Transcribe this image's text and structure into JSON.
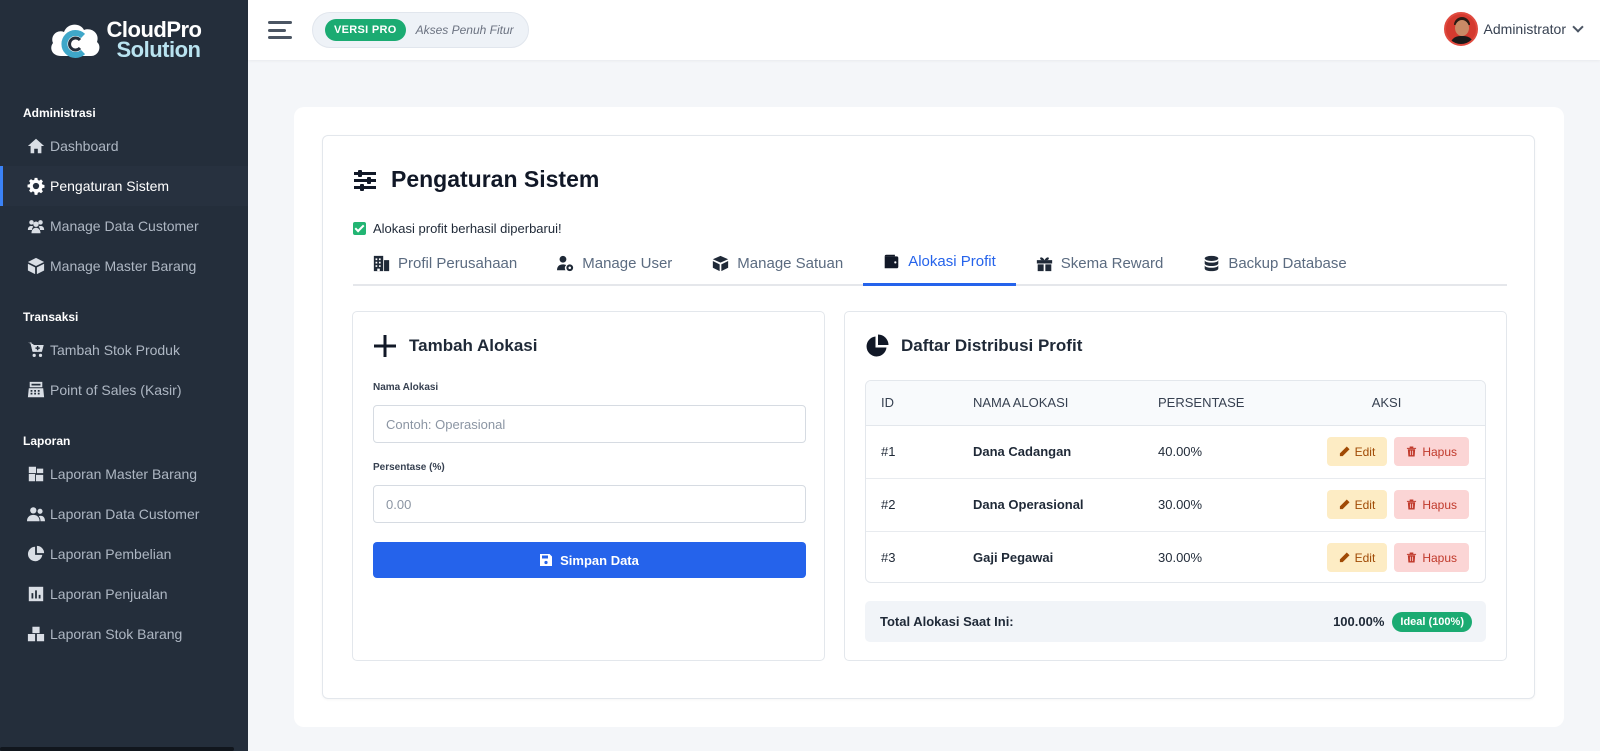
{
  "brand": {
    "line1": "CloudPro",
    "line2": "Solution"
  },
  "sidebar": {
    "sections": [
      {
        "title": "Administrasi",
        "items": [
          {
            "label": "Dashboard",
            "icon": "home-icon"
          },
          {
            "label": "Pengaturan Sistem",
            "icon": "gear-icon",
            "active": true
          },
          {
            "label": "Manage Data Customer",
            "icon": "users-icon"
          },
          {
            "label": "Manage Master Barang",
            "icon": "box-icon"
          }
        ]
      },
      {
        "title": "Transaksi",
        "items": [
          {
            "label": "Tambah Stok Produk",
            "icon": "cart-plus-icon"
          },
          {
            "label": "Point of Sales (Kasir)",
            "icon": "cash-register-icon"
          }
        ]
      },
      {
        "title": "Laporan",
        "items": [
          {
            "label": "Laporan Master Barang",
            "icon": "boxes-report-icon"
          },
          {
            "label": "Laporan Data Customer",
            "icon": "user-group-icon"
          },
          {
            "label": "Laporan Pembelian",
            "icon": "pie-chart-icon"
          },
          {
            "label": "Laporan Penjualan",
            "icon": "bar-chart-icon"
          },
          {
            "label": "Laporan Stok Barang",
            "icon": "stock-boxes-icon"
          }
        ]
      }
    ]
  },
  "topbar": {
    "pro_badge": "VERSI PRO",
    "pro_text": "Akses Penuh Fitur",
    "user_name": "Administrator"
  },
  "page": {
    "title": "Pengaturan Sistem",
    "alert": "Alokasi profit berhasil diperbarui!",
    "tabs": [
      {
        "label": "Profil Perusahaan",
        "icon": "building-icon"
      },
      {
        "label": "Manage User",
        "icon": "user-gear-icon"
      },
      {
        "label": "Manage Satuan",
        "icon": "box-open-icon"
      },
      {
        "label": "Alokasi Profit",
        "icon": "wallet-icon",
        "active": true
      },
      {
        "label": "Skema Reward",
        "icon": "gift-icon"
      },
      {
        "label": "Backup Database",
        "icon": "database-icon"
      }
    ]
  },
  "form": {
    "title": "Tambah Alokasi",
    "name_label": "Nama Alokasi",
    "name_placeholder": "Contoh: Operasional",
    "pct_label": "Persentase (%)",
    "pct_placeholder": "0.00",
    "save_label": "Simpan Data"
  },
  "distribution": {
    "title": "Daftar Distribusi Profit",
    "columns": [
      "ID",
      "NAMA ALOKASI",
      "PERSENTASE",
      "AKSI"
    ],
    "rows": [
      {
        "id": "#1",
        "name": "Dana Cadangan",
        "pct": "40.00%"
      },
      {
        "id": "#2",
        "name": "Dana Operasional",
        "pct": "30.00%"
      },
      {
        "id": "#3",
        "name": "Gaji Pegawai",
        "pct": "30.00%"
      }
    ],
    "edit_label": "Edit",
    "delete_label": "Hapus",
    "total_label": "Total Alokasi Saat Ini:",
    "total_value": "100.00%",
    "total_badge": "Ideal (100%)"
  },
  "colors": {
    "accent": "#2563eb",
    "success": "#1bab72",
    "sidebar": "#242e3b"
  }
}
